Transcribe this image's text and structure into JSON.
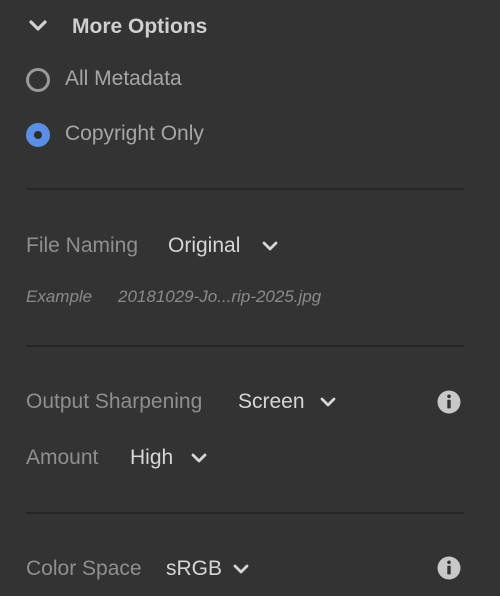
{
  "section": {
    "title": "More Options",
    "expand_icon": "chevron-down-icon"
  },
  "metadata": {
    "options": [
      {
        "label": "All Metadata",
        "selected": false
      },
      {
        "label": "Copyright Only",
        "selected": true
      }
    ],
    "accent_color": "#5b8fe6"
  },
  "file_naming": {
    "label": "File Naming",
    "value": "Original",
    "example_label": "Example",
    "example_value": "20181029-Jo...rip-2025.jpg"
  },
  "output_sharpening": {
    "label": "Output Sharpening",
    "value": "Screen",
    "info_icon": "info-icon"
  },
  "amount": {
    "label": "Amount",
    "value": "High"
  },
  "color_space": {
    "label": "Color Space",
    "value": "sRGB",
    "info_icon": "info-icon"
  }
}
